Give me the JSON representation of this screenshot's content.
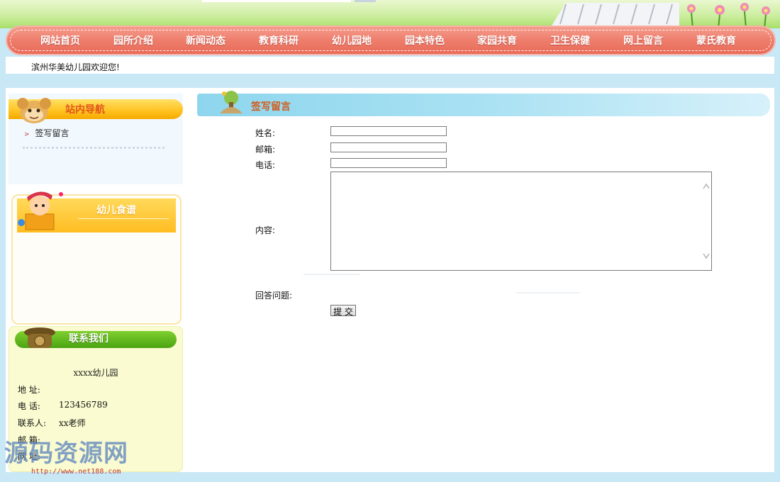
{
  "nav": {
    "items": [
      "网站首页",
      "园所介绍",
      "新闻动态",
      "教育科研",
      "幼儿园地",
      "园本特色",
      "家园共育",
      "卫生保健",
      "网上留言",
      "蒙氏教育"
    ]
  },
  "welcome": {
    "text": "滨州华美幼儿园欢迎您!"
  },
  "sidebar": {
    "sitenav": {
      "title": "站内导航",
      "items": [
        "签写留言"
      ]
    },
    "recipes": {
      "title": "幼儿食谱"
    },
    "contact": {
      "title": "联系我们",
      "name": "xxxx幼儿园",
      "address_label": "地 址:",
      "address_value": "",
      "phone_label": "电 话:",
      "phone_value": "123456789",
      "person_label": "联系人:",
      "person_value": "xx老师",
      "email_label": "邮 箱:",
      "email_value": "",
      "site_label": "网 址:",
      "site_value": ""
    }
  },
  "form": {
    "title": "签写留言",
    "name_label": "姓名:",
    "email_label": "邮箱:",
    "phone_label": "电话:",
    "content_label": "内容:",
    "question_label": "回答问题:",
    "name_value": "",
    "email_value": "",
    "phone_value": "",
    "content_value": "",
    "submit_label": "提 交"
  },
  "watermark": {
    "brand": "源码资源网",
    "url": "http://www.net188.com"
  },
  "colors": {
    "nav_bg": "#ee7d6c",
    "page_bg": "#c9e8f6",
    "orange_bar": "#ffc21f",
    "green_bar": "#4aa412",
    "sky_bar": "#a9e1f3",
    "title_orange": "#d35a1a"
  }
}
